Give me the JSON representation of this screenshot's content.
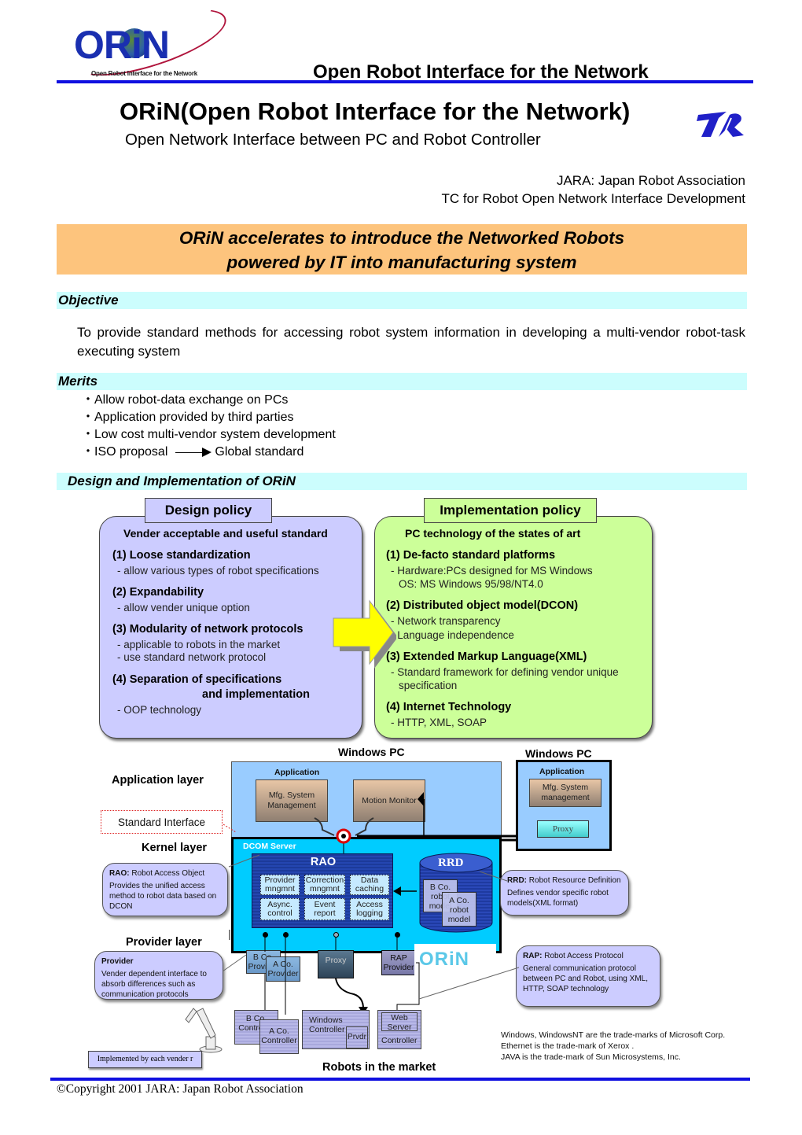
{
  "header": {
    "logo_text": "ORiN",
    "logo_tagline": "Open Robot Interface for the Network",
    "title": "Open Robot Interface for the Network",
    "main_title": "ORiN(Open Robot Interface for the Network)",
    "subtitle": "Open Network Interface between PC and Robot Controller",
    "org_line1": "JARA: Japan Robot Association",
    "org_line2": "TC for Robot Open Network Interface Development"
  },
  "banner": {
    "line1": "ORiN accelerates to introduce the Networked Robots",
    "line2": "powered by IT into manufacturing system",
    "color": "#fdc47d"
  },
  "objective": {
    "heading": "Objective",
    "text": "To provide standard methods for accessing robot system information in developing a multi-vendor robot-task executing system"
  },
  "merits": {
    "heading": "Merits",
    "bullet": "・",
    "items": [
      "Allow robot-data exchange on PCs",
      "Application provided by third parties",
      "Low cost multi-vendor system development"
    ],
    "iso_from": "ISO proposal",
    "iso_to": "Global standard"
  },
  "design_impl": {
    "heading": "Design and Implementation of ORiN",
    "design": {
      "tab": "Design policy",
      "head": "Vender acceptable and useful standard",
      "items": [
        {
          "title": "(1) Loose standardization",
          "subs": [
            "- allow various types of robot specifications"
          ]
        },
        {
          "title": "(2) Expandability",
          "subs": [
            "- allow vender unique option"
          ]
        },
        {
          "title": "(3) Modularity of network protocols",
          "subs": [
            "- applicable to robots in the market",
            "- use standard network protocol"
          ]
        },
        {
          "title": "(4) Separation of specifications",
          "title2": "and implementation",
          "subs": [
            "- OOP technology"
          ]
        }
      ]
    },
    "implementation": {
      "tab": "Implementation policy",
      "head": "PC technology of the states of art",
      "items": [
        {
          "title": "(1) De-facto standard platforms",
          "subs": [
            "- Hardware:PCs designed for MS Windows",
            "OS: MS Windows 95/98/NT4.0"
          ]
        },
        {
          "title": "(2) Distributed object model(DCON)",
          "subs": [
            "- Network transparency",
            "- Language independence"
          ]
        },
        {
          "title": "(3) Extended Markup Language(XML)",
          "subs": [
            "- Standard framework for defining vendor unique",
            "specification"
          ]
        },
        {
          "title": "(4) Internet Technology",
          "subs": [
            "- HTTP, XML, SOAP"
          ]
        }
      ]
    }
  },
  "diagram": {
    "windows_pc_1": "Windows PC",
    "windows_pc_2": "Windows PC",
    "application_layer": "Application layer",
    "kernel_layer": "Kernel layer",
    "provider_layer": "Provider  layer",
    "standard_interface": "Standard Interface",
    "application_label": "Application",
    "mfg_system_management": "Mfg. System Management",
    "motion_monitor": "Motion Monitor",
    "pc2_application": "Application",
    "pc2_mfg": "Mfg. System management",
    "pc2_proxy": "Proxy",
    "dcom_server": "DCOM Server",
    "rao_title": "RAO",
    "rao_cells": [
      "Provider mngmnt",
      "Correction mngmnt",
      "Data caching",
      "Async. control",
      "Event report",
      "Access logging"
    ],
    "rrd_title": "RRD",
    "rrd_models": [
      "B Co. robot model",
      "A Co. robot model"
    ],
    "callouts": {
      "rao": {
        "term": "RAO:",
        "name": "Robot Access Object",
        "desc": "Provides the unified access method to robot data based on DCON"
      },
      "rrd": {
        "term": "RRD:",
        "name": "Robot Resource Definition",
        "desc": "Defines vendor specific robot models(XML format)"
      },
      "provider": {
        "term": "Provider",
        "desc": "Vender dependent interface to absorb differences such as communication protocols"
      },
      "rap": {
        "term": "RAP:",
        "name": "Robot Access Protocol",
        "desc": "General communication protocol between PC and Robot, using XML, HTTP, SOAP technology"
      }
    },
    "providers": [
      "B Co. Provider",
      "A Co. Provider",
      "Proxy",
      "RAP Provider"
    ],
    "watermark": "ORiN",
    "controllers": {
      "b_co": "B Co. Controller",
      "a_co": "A Co. Controller",
      "windows": "Windows Controller",
      "prvdr": "Prvdr",
      "web_server": "Web Server",
      "web_controller": "Controller"
    },
    "implemented_note": "Implemented by each vender r",
    "robots_in_market": "Robots in the market"
  },
  "trademarks": [
    "Windows, WindowsNT are the trade-marks of Microsoft Corp.",
    "Ethernet is the trade-mark of Xerox .",
    "JAVA is the trade-mark of Sun Microsystems, Inc."
  ],
  "footer": {
    "copyright": "©Copyright 2001 JARA: Japan Robot Association"
  },
  "colors": {
    "rule_blue": "#1010e0",
    "section_cyan": "#ccfdfd",
    "design_lavender": "#ccccff",
    "impl_green": "#ccff99",
    "dcom_cyan": "#00ccff",
    "pc_blue": "#99ccff"
  }
}
